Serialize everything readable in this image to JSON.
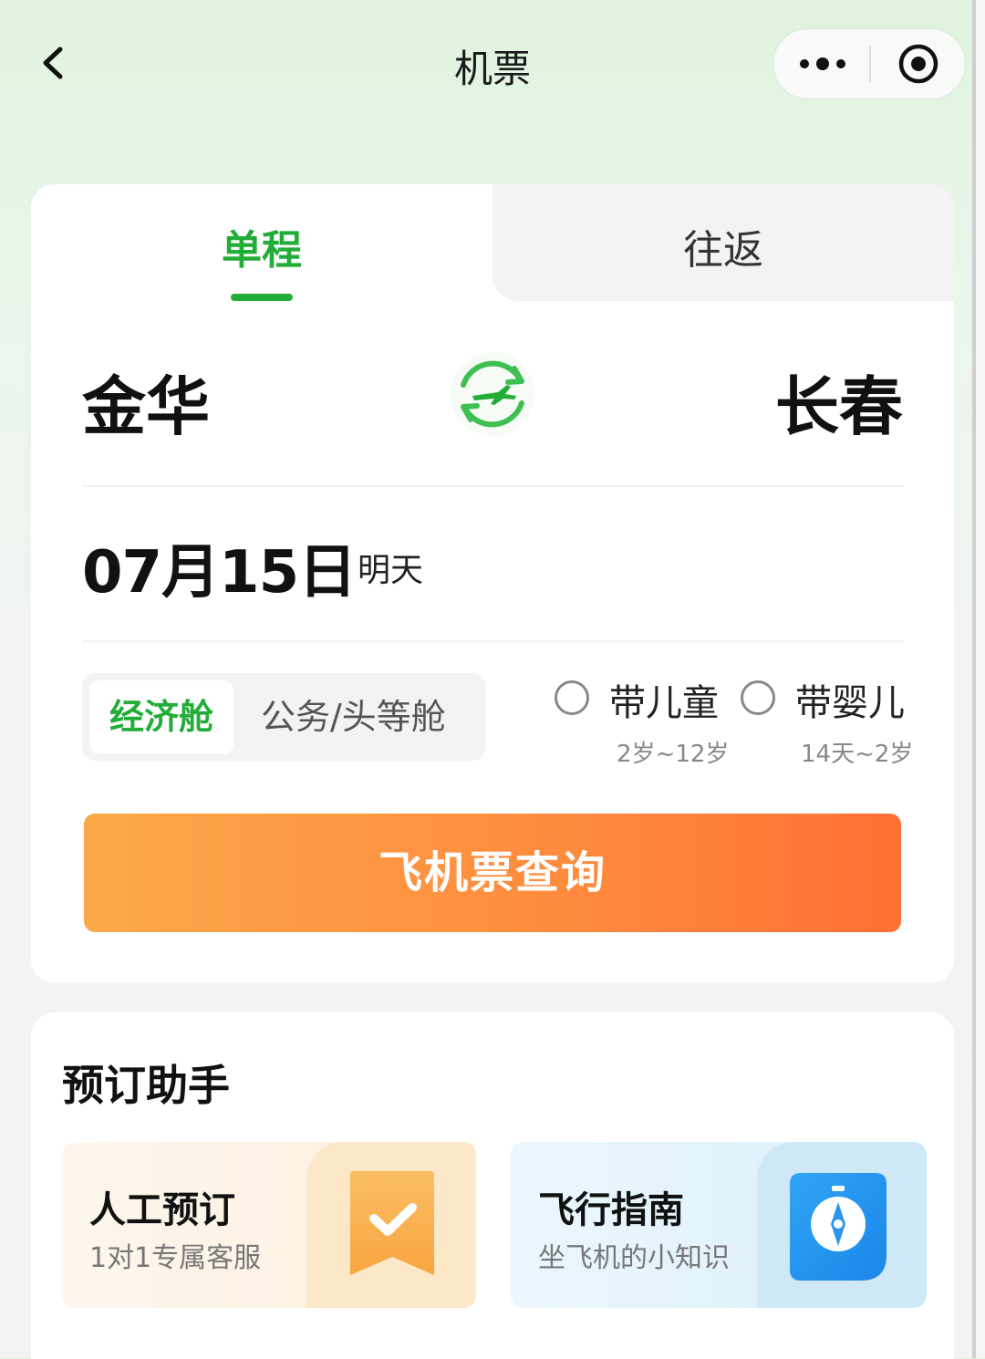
{
  "nav": {
    "title": "机票"
  },
  "trip_tabs": {
    "oneway": "单程",
    "roundtrip": "往返",
    "selected": "单程"
  },
  "route": {
    "from": "金华",
    "to": "长春"
  },
  "date": {
    "value": "07月15日",
    "hint": "明天"
  },
  "cabin": {
    "options": [
      "经济舱",
      "公务/头等舱"
    ],
    "selected": "经济舱"
  },
  "passengers": {
    "child": {
      "label": "带儿童",
      "age": "2岁~12岁",
      "checked": false
    },
    "infant": {
      "label": "带婴儿",
      "age": "14天~2岁",
      "checked": false
    }
  },
  "search_button": "飞机票查询",
  "assistant": {
    "title": "预订助手",
    "items": [
      {
        "title": "人工预订",
        "subtitle": "1对1专属客服",
        "icon": "checkmark-ribbon-icon"
      },
      {
        "title": "飞行指南",
        "subtitle": "坐飞机的小知识",
        "icon": "compass-icon"
      }
    ]
  },
  "colors": {
    "accent": "#22ac38",
    "button_start": "#fba84a",
    "button_end": "#ff7034"
  }
}
